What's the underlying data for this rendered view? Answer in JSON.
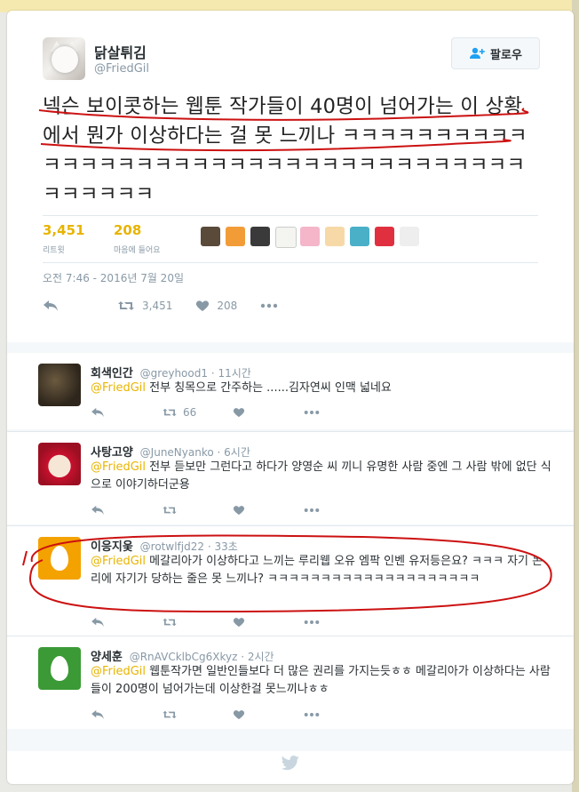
{
  "tweet": {
    "author_name": "닭살튀김",
    "author_handle": "@FriedGil",
    "follow_label": "팔로우",
    "text": "넥슨 보이콧하는 웹툰 작가들이 40명이 넘어가는 이 상황에서 뭔가 이상하다는 걸 못 느끼나 ㅋㅋㅋㅋㅋㅋㅋㅋㅋㅋㅋㅋㅋㅋㅋㅋㅋㅋㅋㅋㅋㅋㅋㅋㅋㅋㅋㅋㅋㅋㅋㅋㅋㅋㅋㅋㅋㅋㅋㅋㅋㅋ",
    "retweets_count": "3,451",
    "retweets_label": "리트윗",
    "likes_count": "208",
    "likes_label": "마음에 들어요",
    "timestamp": "오전 7:46 - 2016년 7월 20일",
    "action_retweets": "3,451",
    "action_likes": "208"
  },
  "replies": [
    {
      "name": "회색인간",
      "handle": "@greyhood1",
      "time": "· 11시간",
      "mention": "@FriedGil",
      "text": " 전부 칭목으로 간주하는 ......김자연씨 인맥 넓네요",
      "retweets": "66"
    },
    {
      "name": "사탕고양",
      "handle": "@JuneNyanko",
      "time": "· 6시간",
      "mention": "@FriedGil",
      "text": " 전부 듣보만 그런다고 하다가 양영순 씨 끼니 유명한 사람 중엔 그 사람 밖에 없단 식으로 이야기하더군용",
      "retweets": ""
    },
    {
      "name": "이응지웆",
      "handle": "@rotwlfjd22",
      "time": "· 33초",
      "mention": "@FriedGil",
      "text": " 메갈리아가 이상하다고 느끼는 루리웹 오유 엠팍 인벤 유저등은요? ㅋㅋㅋ 자기 논리에 자기가 당하는 줄은 못 느끼나? ㅋㅋㅋㅋㅋㅋㅋㅋㅋㅋㅋㅋㅋㅋㅋㅋㅋㅋㅋㅋ",
      "retweets": ""
    },
    {
      "name": "양세훈",
      "handle": "@RnAVCklbCg6Xkyz",
      "time": "· 2시간",
      "mention": "@FriedGil",
      "text": " 웹툰작가면 일반인들보다 더 많은 권리를 가지는듯ㅎㅎ 메갈리아가 이상하다는 사람들이 200명이 넘어가는데 이상한걸 못느끼나ㅎㅎ",
      "retweets": ""
    }
  ],
  "colors": {
    "accent": "#e8b400",
    "muted": "#8899a6",
    "annotation": "#cc1111",
    "egg_orange": "#f4a200",
    "egg_green": "#3b9a36"
  },
  "icons": [
    "person-add-icon",
    "reply-icon",
    "retweet-icon",
    "heart-icon",
    "more-icon",
    "twitter-bird-icon"
  ]
}
